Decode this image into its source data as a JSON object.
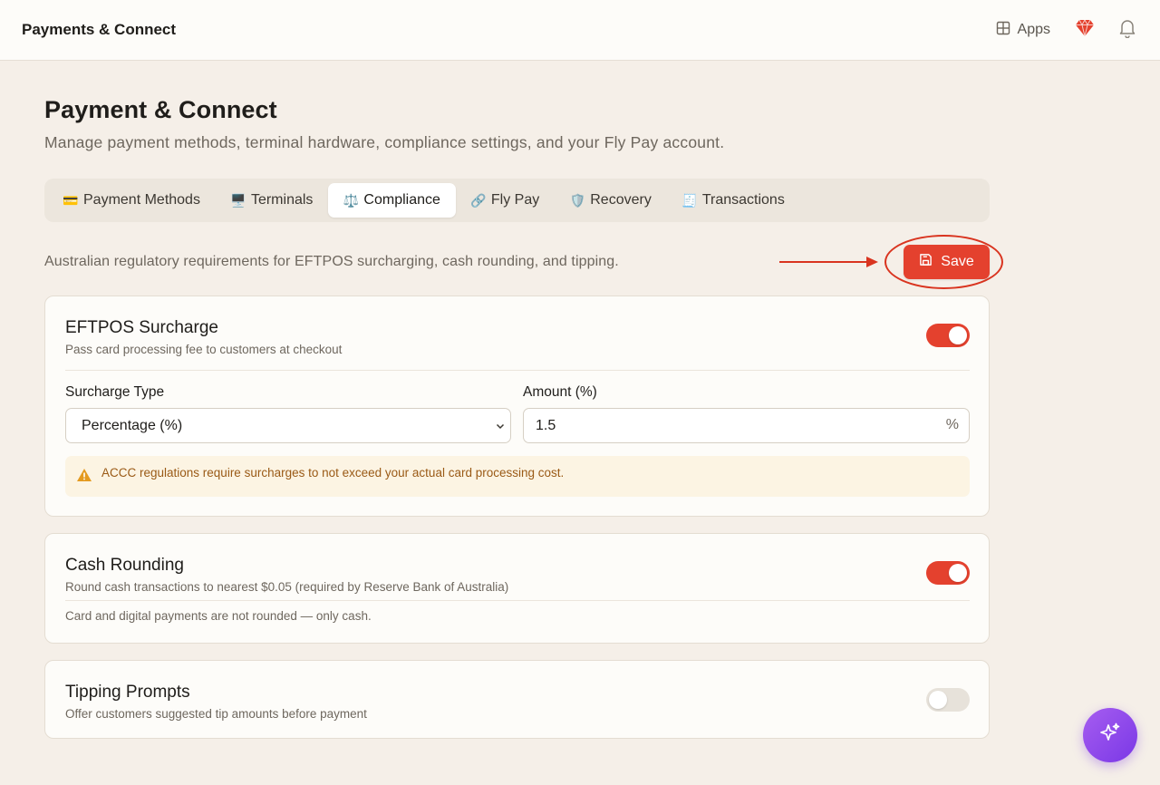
{
  "topbar": {
    "title": "Payments & Connect",
    "apps_label": "Apps",
    "icons": [
      "apps-grid-icon",
      "gem-icon",
      "bell-icon"
    ]
  },
  "page": {
    "title": "Payment & Connect",
    "subtitle": "Manage payment methods, terminal hardware, compliance settings, and your Fly Pay account."
  },
  "tabs": [
    {
      "emoji": "💳",
      "label": "Payment Methods",
      "active": false
    },
    {
      "emoji": "🖥️",
      "label": "Terminals",
      "active": false
    },
    {
      "emoji": "⚖️",
      "label": "Compliance",
      "active": true
    },
    {
      "emoji": "🔗",
      "label": "Fly Pay",
      "active": false
    },
    {
      "emoji": "🛡️",
      "label": "Recovery",
      "active": false
    },
    {
      "emoji": "🧾",
      "label": "Transactions",
      "active": false
    }
  ],
  "compliance": {
    "description": "Australian regulatory requirements for EFTPOS surcharging, cash rounding, and tipping.",
    "save_label": "Save",
    "surcharge": {
      "title": "EFTPOS Surcharge",
      "description": "Pass card processing fee to customers at checkout",
      "enabled": true,
      "type_label": "Surcharge Type",
      "type_value": "Percentage (%)",
      "amount_label": "Amount (%)",
      "amount_value": "1.5",
      "amount_suffix": "%",
      "warning": "ACCC regulations require surcharges to not exceed your actual card processing cost."
    },
    "cash_rounding": {
      "title": "Cash Rounding",
      "description": "Round cash transactions to nearest $0.05 (required by Reserve Bank of Australia)",
      "enabled": true,
      "note": "Card and digital payments are not rounded — only cash."
    },
    "tipping": {
      "title": "Tipping Prompts",
      "description": "Offer customers suggested tip amounts before payment",
      "enabled": false
    }
  },
  "colors": {
    "accent": "#e4412e",
    "background": "#f5efe8",
    "card": "#fdfcf9",
    "warning_bg": "#fcf4e3",
    "warning_text": "#9a5a16",
    "fab": "#8b47ea"
  }
}
